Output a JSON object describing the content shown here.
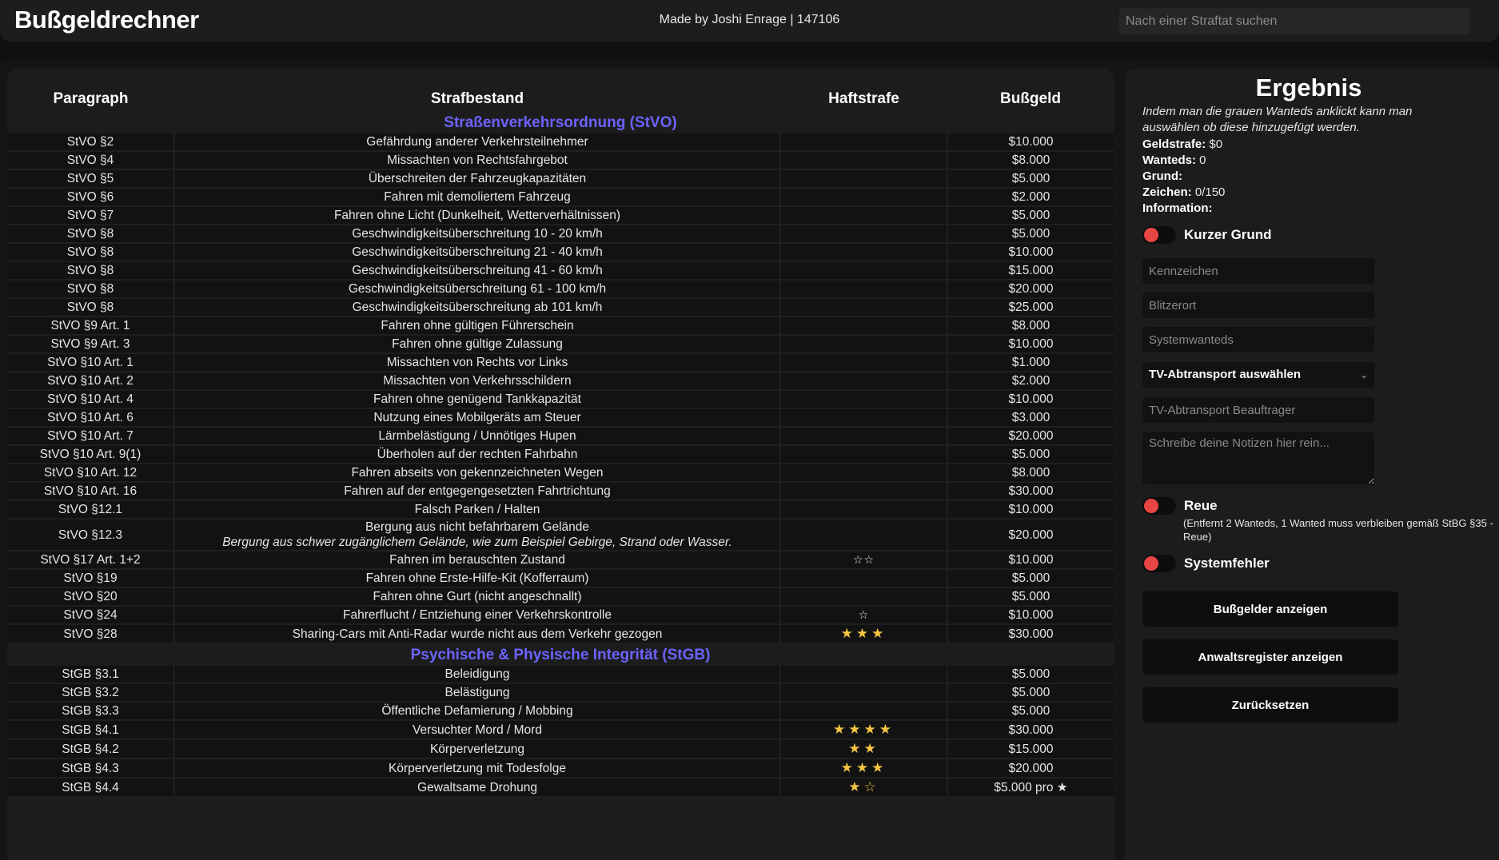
{
  "header": {
    "brand": "Bußgeldrechner",
    "credit": "Made by Joshi Enrage | 147106",
    "search_placeholder": "Nach einer Straftat suchen"
  },
  "table": {
    "columns": [
      "Paragraph",
      "Strafbestand",
      "Haftstrafe",
      "Bußgeld"
    ],
    "sections": [
      {
        "title": "Straßenverkehrsordnung (StVO)",
        "rows": [
          {
            "p": "StVO §2",
            "d": "Gefährdung anderer Verkehrsteilnehmer",
            "h": "",
            "b": "$10.000"
          },
          {
            "p": "StVO §4",
            "d": "Missachten von Rechtsfahrgebot",
            "h": "",
            "b": "$8.000"
          },
          {
            "p": "StVO §5",
            "d": "Überschreiten der Fahrzeugkapazitäten",
            "h": "",
            "b": "$5.000"
          },
          {
            "p": "StVO §6",
            "d": "Fahren mit demoliertem Fahrzeug",
            "h": "",
            "b": "$2.000"
          },
          {
            "p": "StVO §7",
            "d": "Fahren ohne Licht (Dunkelheit, Wetterverhältnissen)",
            "h": "",
            "b": "$5.000"
          },
          {
            "p": "StVO §8",
            "d": "Geschwindigkeitsüberschreitung 10 - 20 km/h",
            "h": "",
            "b": "$5.000"
          },
          {
            "p": "StVO §8",
            "d": "Geschwindigkeitsüberschreitung 21 - 40 km/h",
            "h": "",
            "b": "$10.000"
          },
          {
            "p": "StVO §8",
            "d": "Geschwindigkeitsüberschreitung 41 - 60 km/h",
            "h": "",
            "b": "$15.000"
          },
          {
            "p": "StVO §8",
            "d": "Geschwindigkeitsüberschreitung 61 - 100 km/h",
            "h": "",
            "b": "$20.000"
          },
          {
            "p": "StVO §8",
            "d": "Geschwindigkeitsüberschreitung ab 101 km/h",
            "h": "",
            "b": "$25.000"
          },
          {
            "p": "StVO §9 Art. 1",
            "d": "Fahren ohne gültigen Führerschein",
            "h": "",
            "b": "$8.000"
          },
          {
            "p": "StVO §9 Art. 3",
            "d": "Fahren ohne gültige Zulassung",
            "h": "",
            "b": "$10.000"
          },
          {
            "p": "StVO §10 Art. 1",
            "d": "Missachten von Rechts vor Links",
            "h": "",
            "b": "$1.000"
          },
          {
            "p": "StVO §10 Art. 2",
            "d": "Missachten von Verkehrsschildern",
            "h": "",
            "b": "$2.000"
          },
          {
            "p": "StVO §10 Art. 4",
            "d": "Fahren ohne genügend Tankkapazität",
            "h": "",
            "b": "$10.000"
          },
          {
            "p": "StVO §10 Art. 6",
            "d": "Nutzung eines Mobilgeräts am Steuer",
            "h": "",
            "b": "$3.000"
          },
          {
            "p": "StVO §10 Art. 7",
            "d": "Lärmbelästigung / Unnötiges Hupen",
            "h": "",
            "b": "$20.000"
          },
          {
            "p": "StVO §10 Art. 9(1)",
            "d": "Überholen auf der rechten Fahrbahn",
            "h": "",
            "b": "$5.000"
          },
          {
            "p": "StVO §10 Art. 12",
            "d": "Fahren abseits von gekennzeichneten Wegen",
            "h": "",
            "b": "$8.000"
          },
          {
            "p": "StVO §10 Art. 16",
            "d": "Fahren auf der entgegengesetzten Fahrtrichtung",
            "h": "",
            "b": "$30.000"
          },
          {
            "p": "StVO §12.1",
            "d": "Falsch Parken / Halten",
            "h": "",
            "b": "$10.000"
          },
          {
            "p": "StVO §12.3",
            "d": "Bergung aus nicht befahrbarem Gelände",
            "note": "Bergung aus schwer zugänglichem Gelände, wie zum Beispiel Gebirge, Strand oder Wasser.",
            "h": "",
            "b": "$20.000"
          },
          {
            "p": "StVO §17 Art. 1+2",
            "d": "Fahren im berauschten Zustand",
            "h": "☆☆",
            "hs": "outline",
            "b": "$10.000"
          },
          {
            "p": "StVO §19",
            "d": "Fahren ohne Erste-Hilfe-Kit (Kofferraum)",
            "h": "",
            "b": "$5.000"
          },
          {
            "p": "StVO §20",
            "d": "Fahren ohne Gurt (nicht angeschnallt)",
            "h": "",
            "b": "$5.000"
          },
          {
            "p": "StVO §24",
            "d": "Fahrerflucht / Entziehung einer Verkehrskontrolle",
            "h": "☆",
            "hs": "outline",
            "b": "$10.000"
          },
          {
            "p": "StVO §28",
            "d": "Sharing-Cars mit Anti-Radar wurde nicht aus dem Verkehr gezogen",
            "h": "★★★",
            "hs": "filled",
            "b": "$30.000"
          }
        ]
      },
      {
        "title": "Psychische & Physische Integrität (StGB)",
        "rows": [
          {
            "p": "StGB §3.1",
            "d": "Beleidigung",
            "h": "",
            "b": "$5.000"
          },
          {
            "p": "StGB §3.2",
            "d": "Belästigung",
            "h": "",
            "b": "$5.000"
          },
          {
            "p": "StGB §3.3",
            "d": "Öffentliche Defamierung / Mobbing",
            "h": "",
            "b": "$5.000"
          },
          {
            "p": "StGB §4.1",
            "d": "Versuchter Mord / Mord",
            "h": "★★★★",
            "hs": "filled",
            "b": "$30.000"
          },
          {
            "p": "StGB §4.2",
            "d": "Körperverletzung",
            "h": "★★",
            "hs": "filled",
            "b": "$15.000"
          },
          {
            "p": "StGB §4.3",
            "d": "Körperverletzung mit Todesfolge",
            "h": "★★★",
            "hs": "filled",
            "b": "$20.000"
          },
          {
            "p": "StGB §4.4",
            "d": "Gewaltsame Drohung",
            "h": "★☆",
            "hs": "filled",
            "b": "$5.000 pro ★"
          }
        ]
      }
    ]
  },
  "result": {
    "title": "Ergebnis",
    "hint": "Indem man die grauen Wanteds anklickt kann man auswählen ob diese hinzugefügt werden.",
    "fine_label": "Geldstrafe:",
    "fine_value": "$0",
    "wanteds_label": "Wanteds:",
    "wanteds_value": "0",
    "reason_label": "Grund:",
    "reason_value": "",
    "chars_label": "Zeichen:",
    "chars_value": "0/150",
    "info_label": "Information:",
    "toggle_short_reason": "Kurzer Grund",
    "plate_placeholder": "Kennzeichen",
    "flash_placeholder": "Blitzerort",
    "system_wanteds_placeholder": "Systemwanteds",
    "tow_select": "TV-Abtransport auswählen",
    "tow_officer_placeholder": "TV-Abtransport Beauftrager",
    "notes_placeholder": "Schreibe deine Notizen hier rein...",
    "toggle_remorse": "Reue",
    "remorse_note": "(Entfernt 2 Wanteds, 1 Wanted muss verbleiben gemäß StBG §35 - Reue)",
    "toggle_system_error": "Systemfehler",
    "btn_fines": "Bußgelder anzeigen",
    "btn_lawyers": "Anwaltsregister anzeigen",
    "btn_reset": "Zurücksetzen"
  },
  "colors": {
    "section_title": "#6c63ff",
    "toggle_off": "#e84545",
    "star": "#f5c542"
  }
}
